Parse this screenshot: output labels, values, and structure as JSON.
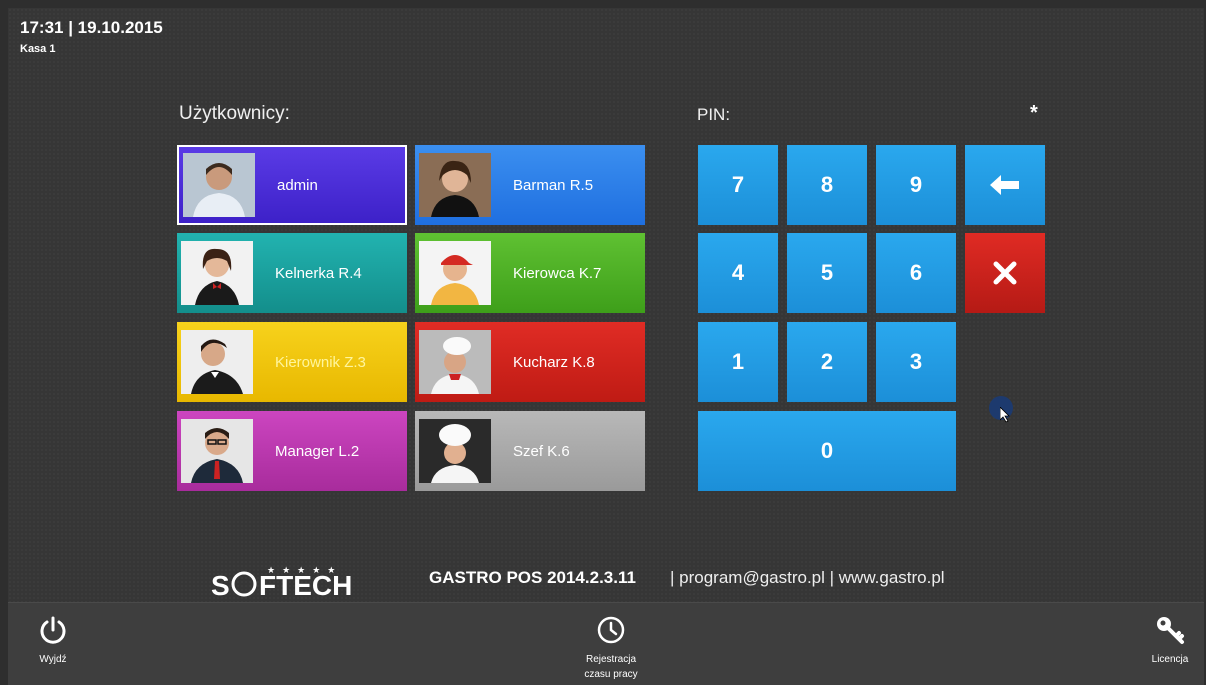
{
  "header": {
    "time_date": "17:31 | 19.10.2015",
    "register": "Kasa 1"
  },
  "users": {
    "label": "Użytkownicy:",
    "items": [
      {
        "name": "admin",
        "color": "#4a2bd8",
        "selected": true
      },
      {
        "name": "Barman R.5",
        "color": "#2a7fe8"
      },
      {
        "name": "Kelnerka R.4",
        "color": "#1aa3a0"
      },
      {
        "name": "Kierowca K.7",
        "color": "#52b428"
      },
      {
        "name": "Kierownik Z.3",
        "color": "#f2c90e"
      },
      {
        "name": "Kucharz K.8",
        "color": "#d7231e"
      },
      {
        "name": "Manager L.2",
        "color": "#c43bb8"
      },
      {
        "name": "Szef K.6",
        "color": "#a9a9a9"
      }
    ]
  },
  "pin": {
    "label": "PIN:",
    "value": "*",
    "keys": {
      "k7": "7",
      "k8": "8",
      "k9": "9",
      "k4": "4",
      "k5": "5",
      "k6": "6",
      "k1": "1",
      "k2": "2",
      "k3": "3",
      "k0": "0"
    }
  },
  "footer": {
    "brand": "SOFTECH",
    "version": "GASTRO POS 2014.2.3.11",
    "contact": "| program@gastro.pl | www.gastro.pl"
  },
  "bottom_bar": {
    "exit": "Wyjdź",
    "time_reg_line1": "Rejestracja",
    "time_reg_line2": "czasu pracy",
    "license": "Licencja"
  },
  "icons": {
    "exit": "power-icon",
    "time": "clock-icon",
    "license": "key-icon",
    "backspace": "arrow-left-icon",
    "clear": "x-icon"
  }
}
